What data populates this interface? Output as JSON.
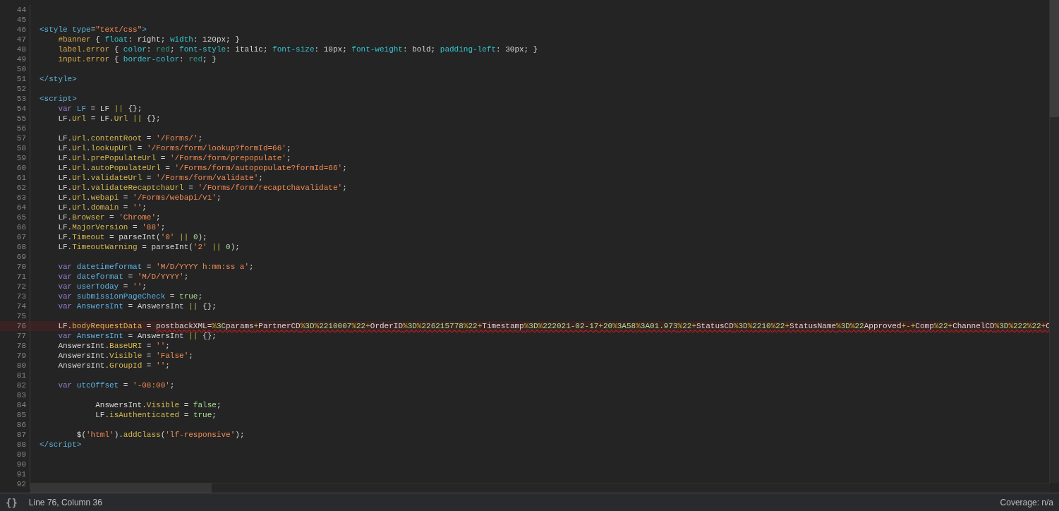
{
  "editor": {
    "lines": [
      {
        "number": "44",
        "current": false
      },
      {
        "number": "45",
        "current": false
      },
      {
        "number": "46",
        "current": false,
        "tokens": [
          {
            "kind": "tag",
            "text": "<style "
          },
          {
            "kind": "attr",
            "text": "type"
          },
          {
            "kind": "plain",
            "text": "="
          },
          {
            "kind": "str",
            "text": "\"text/css\""
          },
          {
            "kind": "tag",
            "text": ">"
          }
        ]
      },
      {
        "number": "47",
        "current": false,
        "tokens": [
          {
            "kind": "sel",
            "text": "    #banner"
          },
          {
            "kind": "plain",
            "text": " { "
          },
          {
            "kind": "prop",
            "text": "float"
          },
          {
            "kind": "plain",
            "text": ": right; "
          },
          {
            "kind": "prop",
            "text": "width"
          },
          {
            "kind": "plain",
            "text": ": 120px; }"
          }
        ]
      },
      {
        "number": "48",
        "current": false,
        "tokens": [
          {
            "kind": "sel",
            "text": "    label.error"
          },
          {
            "kind": "plain",
            "text": " { "
          },
          {
            "kind": "prop",
            "text": "color"
          },
          {
            "kind": "plain",
            "text": ": "
          },
          {
            "kind": "cval",
            "text": "red"
          },
          {
            "kind": "plain",
            "text": "; "
          },
          {
            "kind": "prop",
            "text": "font-style"
          },
          {
            "kind": "plain",
            "text": ": italic; "
          },
          {
            "kind": "prop",
            "text": "font-size"
          },
          {
            "kind": "plain",
            "text": ": 10px; "
          },
          {
            "kind": "prop",
            "text": "font-weight"
          },
          {
            "kind": "plain",
            "text": ": bold; "
          },
          {
            "kind": "prop",
            "text": "padding-left"
          },
          {
            "kind": "plain",
            "text": ": 30px; }"
          }
        ]
      },
      {
        "number": "49",
        "current": false,
        "tokens": [
          {
            "kind": "sel",
            "text": "    input.error"
          },
          {
            "kind": "plain",
            "text": " { "
          },
          {
            "kind": "prop",
            "text": "border-color"
          },
          {
            "kind": "plain",
            "text": ": "
          },
          {
            "kind": "cval",
            "text": "red"
          },
          {
            "kind": "plain",
            "text": "; }"
          }
        ]
      },
      {
        "number": "50",
        "current": false
      },
      {
        "number": "51",
        "current": false,
        "tokens": [
          {
            "kind": "tag",
            "text": "</style>"
          }
        ]
      },
      {
        "number": "52",
        "current": false
      },
      {
        "number": "53",
        "current": false,
        "tokens": [
          {
            "kind": "tag",
            "text": "<script>"
          }
        ]
      },
      {
        "number": "54",
        "current": false,
        "tokens": [
          {
            "kind": "kw",
            "text": "    var "
          },
          {
            "kind": "def",
            "text": "LF"
          },
          {
            "kind": "plain",
            "text": " = LF "
          },
          {
            "kind": "op",
            "text": "||"
          },
          {
            "kind": "plain",
            "text": " {};"
          }
        ]
      },
      {
        "number": "55",
        "current": false,
        "tokens": [
          {
            "kind": "plain",
            "text": "    LF."
          },
          {
            "kind": "field",
            "text": "Url"
          },
          {
            "kind": "plain",
            "text": " = LF."
          },
          {
            "kind": "field",
            "text": "Url"
          },
          {
            "kind": "op",
            "text": " || "
          },
          {
            "kind": "plain",
            "text": "{};"
          }
        ]
      },
      {
        "number": "56",
        "current": false
      },
      {
        "number": "57",
        "current": false,
        "tokens": [
          {
            "kind": "plain",
            "text": "    LF."
          },
          {
            "kind": "field",
            "text": "Url"
          },
          {
            "kind": "plain",
            "text": "."
          },
          {
            "kind": "field",
            "text": "contentRoot"
          },
          {
            "kind": "plain",
            "text": " = "
          },
          {
            "kind": "str",
            "text": "'/Forms/'"
          },
          {
            "kind": "plain",
            "text": ";"
          }
        ]
      },
      {
        "number": "58",
        "current": false,
        "tokens": [
          {
            "kind": "plain",
            "text": "    LF."
          },
          {
            "kind": "field",
            "text": "Url"
          },
          {
            "kind": "plain",
            "text": "."
          },
          {
            "kind": "field",
            "text": "lookupUrl"
          },
          {
            "kind": "plain",
            "text": " = "
          },
          {
            "kind": "str",
            "text": "'/Forms/form/lookup?formId=66'"
          },
          {
            "kind": "plain",
            "text": ";"
          }
        ]
      },
      {
        "number": "59",
        "current": false,
        "tokens": [
          {
            "kind": "plain",
            "text": "    LF."
          },
          {
            "kind": "field",
            "text": "Url"
          },
          {
            "kind": "plain",
            "text": "."
          },
          {
            "kind": "field",
            "text": "prePopulateUrl"
          },
          {
            "kind": "plain",
            "text": " = "
          },
          {
            "kind": "str",
            "text": "'/Forms/form/prepopulate'"
          },
          {
            "kind": "plain",
            "text": ";"
          }
        ]
      },
      {
        "number": "60",
        "current": false,
        "tokens": [
          {
            "kind": "plain",
            "text": "    LF."
          },
          {
            "kind": "field",
            "text": "Url"
          },
          {
            "kind": "plain",
            "text": "."
          },
          {
            "kind": "field",
            "text": "autoPopulateUrl"
          },
          {
            "kind": "plain",
            "text": " = "
          },
          {
            "kind": "str",
            "text": "'/Forms/form/autopopulate?formId=66'"
          },
          {
            "kind": "plain",
            "text": ";"
          }
        ]
      },
      {
        "number": "61",
        "current": false,
        "tokens": [
          {
            "kind": "plain",
            "text": "    LF."
          },
          {
            "kind": "field",
            "text": "Url"
          },
          {
            "kind": "plain",
            "text": "."
          },
          {
            "kind": "field",
            "text": "validateUrl"
          },
          {
            "kind": "plain",
            "text": " = "
          },
          {
            "kind": "str",
            "text": "'/Forms/form/validate'"
          },
          {
            "kind": "plain",
            "text": ";"
          }
        ]
      },
      {
        "number": "62",
        "current": false,
        "tokens": [
          {
            "kind": "plain",
            "text": "    LF."
          },
          {
            "kind": "field",
            "text": "Url"
          },
          {
            "kind": "plain",
            "text": "."
          },
          {
            "kind": "field",
            "text": "validateRecaptchaUrl"
          },
          {
            "kind": "plain",
            "text": " = "
          },
          {
            "kind": "str",
            "text": "'/Forms/form/recaptchavalidate'"
          },
          {
            "kind": "plain",
            "text": ";"
          }
        ]
      },
      {
        "number": "63",
        "current": false,
        "tokens": [
          {
            "kind": "plain",
            "text": "    LF."
          },
          {
            "kind": "field",
            "text": "Url"
          },
          {
            "kind": "plain",
            "text": "."
          },
          {
            "kind": "field",
            "text": "webapi"
          },
          {
            "kind": "plain",
            "text": " = "
          },
          {
            "kind": "str",
            "text": "'/Forms/webapi/v1'"
          },
          {
            "kind": "plain",
            "text": ";"
          }
        ]
      },
      {
        "number": "64",
        "current": false,
        "tokens": [
          {
            "kind": "plain",
            "text": "    LF."
          },
          {
            "kind": "field",
            "text": "Url"
          },
          {
            "kind": "plain",
            "text": "."
          },
          {
            "kind": "field",
            "text": "domain"
          },
          {
            "kind": "plain",
            "text": " = "
          },
          {
            "kind": "str",
            "text": "''"
          },
          {
            "kind": "plain",
            "text": ";"
          }
        ]
      },
      {
        "number": "65",
        "current": false,
        "tokens": [
          {
            "kind": "plain",
            "text": "    LF."
          },
          {
            "kind": "field",
            "text": "Browser"
          },
          {
            "kind": "plain",
            "text": " = "
          },
          {
            "kind": "str",
            "text": "'Chrome'"
          },
          {
            "kind": "plain",
            "text": ";"
          }
        ]
      },
      {
        "number": "66",
        "current": false,
        "tokens": [
          {
            "kind": "plain",
            "text": "    LF."
          },
          {
            "kind": "field",
            "text": "MajorVersion"
          },
          {
            "kind": "plain",
            "text": " = "
          },
          {
            "kind": "str",
            "text": "'88'"
          },
          {
            "kind": "plain",
            "text": ";"
          }
        ]
      },
      {
        "number": "67",
        "current": false,
        "tokens": [
          {
            "kind": "plain",
            "text": "    LF."
          },
          {
            "kind": "field",
            "text": "Timeout"
          },
          {
            "kind": "plain",
            "text": " = parseInt("
          },
          {
            "kind": "str",
            "text": "'0'"
          },
          {
            "kind": "op",
            "text": " || "
          },
          {
            "kind": "num",
            "text": "0"
          },
          {
            "kind": "plain",
            "text": ");"
          }
        ]
      },
      {
        "number": "68",
        "current": false,
        "tokens": [
          {
            "kind": "plain",
            "text": "    LF."
          },
          {
            "kind": "field",
            "text": "TimeoutWarning"
          },
          {
            "kind": "plain",
            "text": " = parseInt("
          },
          {
            "kind": "str",
            "text": "'2'"
          },
          {
            "kind": "op",
            "text": " || "
          },
          {
            "kind": "num",
            "text": "0"
          },
          {
            "kind": "plain",
            "text": ");"
          }
        ]
      },
      {
        "number": "69",
        "current": false
      },
      {
        "number": "70",
        "current": false,
        "tokens": [
          {
            "kind": "kw",
            "text": "    var "
          },
          {
            "kind": "def",
            "text": "datetimeformat"
          },
          {
            "kind": "plain",
            "text": " = "
          },
          {
            "kind": "str",
            "text": "'M/D/YYYY h:mm:ss a'"
          },
          {
            "kind": "plain",
            "text": ";"
          }
        ]
      },
      {
        "number": "71",
        "current": false,
        "tokens": [
          {
            "kind": "kw",
            "text": "    var "
          },
          {
            "kind": "def",
            "text": "dateformat"
          },
          {
            "kind": "plain",
            "text": " = "
          },
          {
            "kind": "str",
            "text": "'M/D/YYYY'"
          },
          {
            "kind": "plain",
            "text": ";"
          }
        ]
      },
      {
        "number": "72",
        "current": false,
        "tokens": [
          {
            "kind": "kw",
            "text": "    var "
          },
          {
            "kind": "def",
            "text": "userToday"
          },
          {
            "kind": "plain",
            "text": " = "
          },
          {
            "kind": "str",
            "text": "''"
          },
          {
            "kind": "plain",
            "text": ";"
          }
        ]
      },
      {
        "number": "73",
        "current": false,
        "tokens": [
          {
            "kind": "kw",
            "text": "    var "
          },
          {
            "kind": "def",
            "text": "submissionPageCheck"
          },
          {
            "kind": "plain",
            "text": " = "
          },
          {
            "kind": "num",
            "text": "true"
          },
          {
            "kind": "plain",
            "text": ";"
          }
        ]
      },
      {
        "number": "74",
        "current": false,
        "tokens": [
          {
            "kind": "kw",
            "text": "    var "
          },
          {
            "kind": "def",
            "text": "AnswersInt"
          },
          {
            "kind": "plain",
            "text": " = AnswersInt "
          },
          {
            "kind": "op",
            "text": "||"
          },
          {
            "kind": "plain",
            "text": " {};"
          }
        ]
      },
      {
        "number": "75",
        "current": false
      },
      {
        "number": "76",
        "current": true,
        "tokens": [
          {
            "kind": "plain",
            "text": "    LF."
          },
          {
            "kind": "field",
            "text": "bodyRequestData"
          },
          {
            "kind": "plain",
            "text": " = "
          }
        ],
        "error_tokens": [
          {
            "kind": "plain",
            "text": "postbackXML="
          },
          {
            "kind": "op",
            "text": "%"
          },
          {
            "kind": "num",
            "text": "3C"
          },
          {
            "kind": "plain",
            "text": "params"
          },
          {
            "kind": "op",
            "text": "+"
          },
          {
            "kind": "plain",
            "text": "PartnerCD"
          },
          {
            "kind": "op",
            "text": "%"
          },
          {
            "kind": "num",
            "text": "3D"
          },
          {
            "kind": "op",
            "text": "%"
          },
          {
            "kind": "num",
            "text": "2210007"
          },
          {
            "kind": "op",
            "text": "%"
          },
          {
            "kind": "num",
            "text": "22"
          },
          {
            "kind": "op",
            "text": "+"
          },
          {
            "kind": "plain",
            "text": "OrderID"
          },
          {
            "kind": "op",
            "text": "%"
          },
          {
            "kind": "num",
            "text": "3D"
          },
          {
            "kind": "op",
            "text": "%"
          },
          {
            "kind": "num",
            "text": "226215778"
          },
          {
            "kind": "op",
            "text": "%"
          },
          {
            "kind": "num",
            "text": "22"
          },
          {
            "kind": "op",
            "text": "+"
          },
          {
            "kind": "plain",
            "text": "Timestamp"
          },
          {
            "kind": "op",
            "text": "%"
          },
          {
            "kind": "num",
            "text": "3D"
          },
          {
            "kind": "op",
            "text": "%"
          },
          {
            "kind": "num",
            "text": "222021-02-17"
          },
          {
            "kind": "op",
            "text": "+"
          },
          {
            "kind": "num",
            "text": "20"
          },
          {
            "kind": "op",
            "text": "%"
          },
          {
            "kind": "num",
            "text": "3A58"
          },
          {
            "kind": "op",
            "text": "%"
          },
          {
            "kind": "num",
            "text": "3A01.973"
          },
          {
            "kind": "op",
            "text": "%"
          },
          {
            "kind": "num",
            "text": "22"
          },
          {
            "kind": "op",
            "text": "+"
          },
          {
            "kind": "plain",
            "text": "StatusCD"
          },
          {
            "kind": "op",
            "text": "%"
          },
          {
            "kind": "num",
            "text": "3D"
          },
          {
            "kind": "op",
            "text": "%"
          },
          {
            "kind": "num",
            "text": "2210"
          },
          {
            "kind": "op",
            "text": "%"
          },
          {
            "kind": "num",
            "text": "22"
          },
          {
            "kind": "op",
            "text": "+"
          },
          {
            "kind": "plain",
            "text": "StatusName"
          },
          {
            "kind": "op",
            "text": "%"
          },
          {
            "kind": "num",
            "text": "3D"
          },
          {
            "kind": "op",
            "text": "%"
          },
          {
            "kind": "num",
            "text": "22"
          },
          {
            "kind": "plain",
            "text": "Approved"
          },
          {
            "kind": "op",
            "text": "+-+"
          },
          {
            "kind": "plain",
            "text": "Comp"
          },
          {
            "kind": "op",
            "text": "%"
          },
          {
            "kind": "num",
            "text": "22"
          },
          {
            "kind": "op",
            "text": "+"
          },
          {
            "kind": "plain",
            "text": "ChannelCD"
          },
          {
            "kind": "op",
            "text": "%"
          },
          {
            "kind": "num",
            "text": "3D"
          },
          {
            "kind": "op",
            "text": "%"
          },
          {
            "kind": "num",
            "text": "222"
          },
          {
            "kind": "op",
            "text": "%"
          },
          {
            "kind": "num",
            "text": "22"
          },
          {
            "kind": "op",
            "text": "+"
          },
          {
            "kind": "plain",
            "text": "C"
          }
        ]
      },
      {
        "number": "77",
        "current": false,
        "tokens": [
          {
            "kind": "kw",
            "text": "    var "
          },
          {
            "kind": "def",
            "text": "AnswersInt"
          },
          {
            "kind": "plain",
            "text": " = AnswersInt "
          },
          {
            "kind": "op",
            "text": "||"
          },
          {
            "kind": "plain",
            "text": " {};"
          }
        ]
      },
      {
        "number": "78",
        "current": false,
        "tokens": [
          {
            "kind": "plain",
            "text": "    AnswersInt."
          },
          {
            "kind": "field",
            "text": "BaseURI"
          },
          {
            "kind": "plain",
            "text": " = "
          },
          {
            "kind": "str",
            "text": "''"
          },
          {
            "kind": "plain",
            "text": ";"
          }
        ]
      },
      {
        "number": "79",
        "current": false,
        "tokens": [
          {
            "kind": "plain",
            "text": "    AnswersInt."
          },
          {
            "kind": "field",
            "text": "Visible"
          },
          {
            "kind": "plain",
            "text": " = "
          },
          {
            "kind": "str",
            "text": "'False'"
          },
          {
            "kind": "plain",
            "text": ";"
          }
        ]
      },
      {
        "number": "80",
        "current": false,
        "tokens": [
          {
            "kind": "plain",
            "text": "    AnswersInt."
          },
          {
            "kind": "field",
            "text": "GroupId"
          },
          {
            "kind": "plain",
            "text": " = "
          },
          {
            "kind": "str",
            "text": "''"
          },
          {
            "kind": "plain",
            "text": ";"
          }
        ]
      },
      {
        "number": "81",
        "current": false
      },
      {
        "number": "82",
        "current": false,
        "tokens": [
          {
            "kind": "kw",
            "text": "    var "
          },
          {
            "kind": "def",
            "text": "utcOffset"
          },
          {
            "kind": "plain",
            "text": " = "
          },
          {
            "kind": "str",
            "text": "'-08:00'"
          },
          {
            "kind": "plain",
            "text": ";"
          }
        ]
      },
      {
        "number": "83",
        "current": false
      },
      {
        "number": "84",
        "current": false,
        "tokens": [
          {
            "kind": "plain",
            "text": "            AnswersInt."
          },
          {
            "kind": "field",
            "text": "Visible"
          },
          {
            "kind": "plain",
            "text": " = "
          },
          {
            "kind": "num",
            "text": "false"
          },
          {
            "kind": "plain",
            "text": ";"
          }
        ]
      },
      {
        "number": "85",
        "current": false,
        "tokens": [
          {
            "kind": "plain",
            "text": "            LF."
          },
          {
            "kind": "field",
            "text": "isAuthenticated"
          },
          {
            "kind": "plain",
            "text": " = "
          },
          {
            "kind": "num",
            "text": "true"
          },
          {
            "kind": "plain",
            "text": ";"
          }
        ]
      },
      {
        "number": "86",
        "current": false
      },
      {
        "number": "87",
        "current": false,
        "tokens": [
          {
            "kind": "plain",
            "text": "        $("
          },
          {
            "kind": "str",
            "text": "'html'"
          },
          {
            "kind": "plain",
            "text": ")."
          },
          {
            "kind": "field",
            "text": "addClass"
          },
          {
            "kind": "plain",
            "text": "("
          },
          {
            "kind": "str",
            "text": "'lf-responsive'"
          },
          {
            "kind": "plain",
            "text": ");"
          }
        ]
      },
      {
        "number": "88",
        "current": false,
        "tokens": [
          {
            "kind": "tag",
            "text": "</script>"
          }
        ]
      },
      {
        "number": "89",
        "current": false
      },
      {
        "number": "90",
        "current": false
      },
      {
        "number": "91",
        "current": false
      },
      {
        "number": "92",
        "current": false
      }
    ]
  },
  "status_bar": {
    "pretty_print_button": "{}",
    "cursor_position": "Line 76, Column 36",
    "coverage": "Coverage: n/a"
  }
}
